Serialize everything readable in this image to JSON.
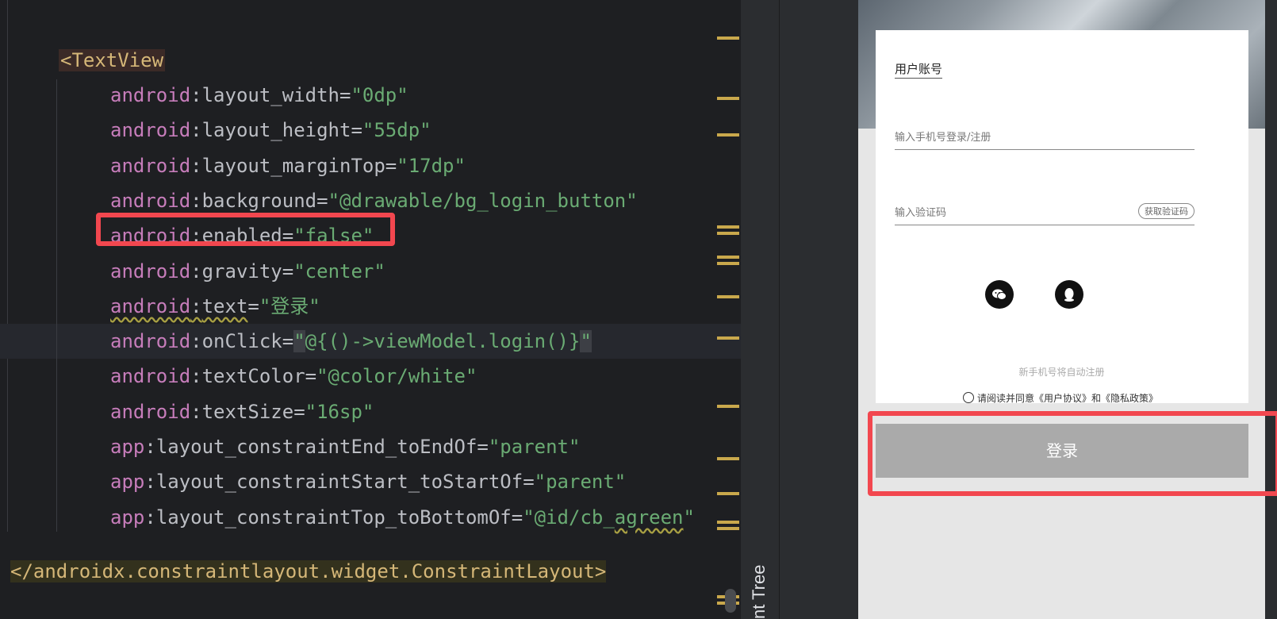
{
  "editor": {
    "open_tag": "<TextView",
    "lines": [
      {
        "ns": "android",
        "attr": "layout_width",
        "value": "\"0dp\""
      },
      {
        "ns": "android",
        "attr": "layout_height",
        "value": "\"55dp\""
      },
      {
        "ns": "android",
        "attr": "layout_marginTop",
        "value": "\"17dp\""
      },
      {
        "ns": "android",
        "attr": "background",
        "value": "\"@drawable/bg_login_button\""
      },
      {
        "ns": "android",
        "attr": "enabled",
        "value": "\"false\""
      },
      {
        "ns": "android",
        "attr": "gravity",
        "value": "\"center\""
      },
      {
        "ns": "android",
        "attr": "text",
        "value": "\"登录\""
      },
      {
        "ns": "android",
        "attr": "onClick",
        "value_open": "\"",
        "value_mid": "@{()->viewModel.login()",
        "value_brace": "}",
        "value_close": "\""
      },
      {
        "ns": "android",
        "attr": "textColor",
        "value": "\"@color/white\""
      },
      {
        "ns": "android",
        "attr": "textSize",
        "value": "\"16sp\""
      },
      {
        "ns": "app",
        "attr": "layout_constraintEnd_toEndOf",
        "value": "\"parent\""
      },
      {
        "ns": "app",
        "attr": "layout_constraintStart_toStartOf",
        "value": "\"parent\""
      },
      {
        "ns": "app",
        "attr": "layout_constraintTop_toBottomOf",
        "value_a": "\"@id/cb_",
        "value_b": "agreen",
        "value_c": "\""
      }
    ],
    "close_tag": "</androidx.constraintlayout.widget.ConstraintLayout>",
    "colon": ":",
    "equals": "="
  },
  "tool_window": {
    "label": "nt Tree"
  },
  "preview": {
    "account_title": "用户账号",
    "phone_placeholder": "输入手机号登录/注册",
    "code_placeholder": "输入验证码",
    "get_code_button": "获取验证码",
    "wechat_icon": "wechat-icon",
    "qq_icon": "qq-icon",
    "hint": "新手机号将自动注册",
    "agreement": "请阅读并同意《用户协议》和《隐私政策》",
    "login_button": "登录",
    "login_button_color": "#aaaaaa"
  },
  "colors": {
    "highlight_box": "#f2474f",
    "string": "#6aab73",
    "namespace": "#c77dbb",
    "tag": "#d5b778"
  }
}
